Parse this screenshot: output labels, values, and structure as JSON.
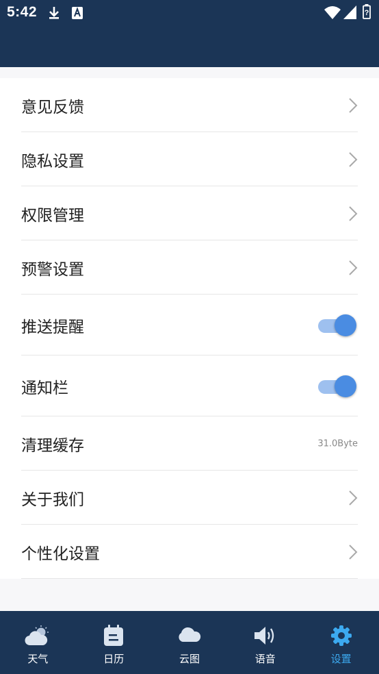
{
  "status_bar": {
    "time": "5:42",
    "icons": [
      "download-icon",
      "a-notification-icon",
      "wifi-icon",
      "signal-icon",
      "battery-icon"
    ]
  },
  "settings": {
    "items": [
      {
        "label": "意见反馈",
        "control": "chevron"
      },
      {
        "label": "隐私设置",
        "control": "chevron"
      },
      {
        "label": "权限管理",
        "control": "chevron"
      },
      {
        "label": "预警设置",
        "control": "chevron"
      },
      {
        "label": "推送提醒",
        "control": "toggle",
        "on": true
      },
      {
        "label": "通知栏",
        "control": "toggle",
        "on": true
      },
      {
        "label": "清理缓存",
        "control": "value",
        "value": "31.0Byte"
      },
      {
        "label": "关于我们",
        "control": "chevron"
      },
      {
        "label": "个性化设置",
        "control": "chevron"
      }
    ]
  },
  "tabbar": {
    "tabs": [
      {
        "label": "天气",
        "icon": "weather-icon"
      },
      {
        "label": "日历",
        "icon": "calendar-icon"
      },
      {
        "label": "云图",
        "icon": "cloud-icon"
      },
      {
        "label": "语音",
        "icon": "speaker-icon"
      },
      {
        "label": "设置",
        "icon": "gear-icon",
        "active": true
      }
    ]
  },
  "colors": {
    "header": "#1b3556",
    "toggle_on": "#4a8ce2",
    "active_tab": "#3ca9ef"
  }
}
